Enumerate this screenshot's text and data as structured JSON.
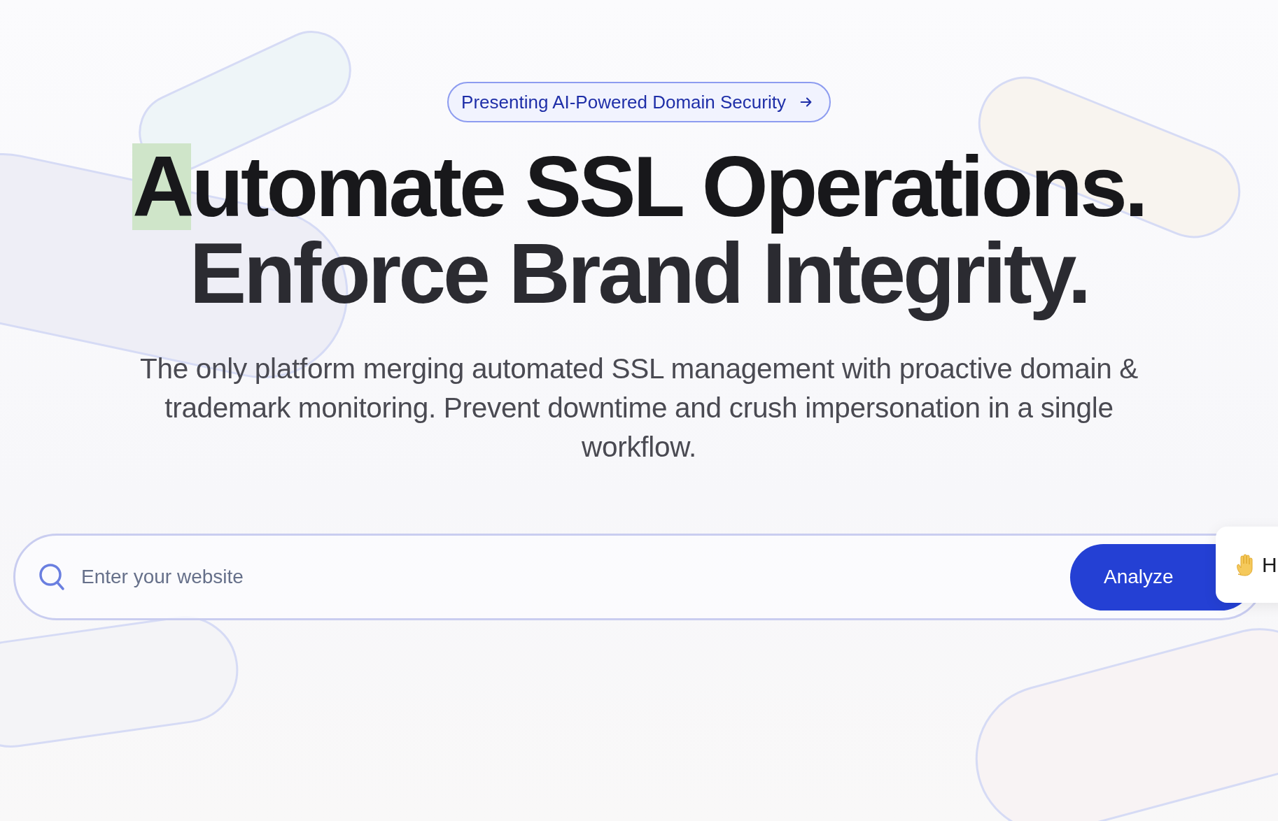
{
  "announcement": {
    "label": "Presenting AI-Powered Domain Security"
  },
  "headline": {
    "lines": [
      {
        "parts": [
          {
            "text": "A",
            "selected": true
          },
          {
            "text": "utomate SSL Operations.",
            "selected": false
          }
        ]
      },
      {
        "parts": [
          {
            "text": "Enforce Brand Integrity.",
            "selected": false
          }
        ]
      }
    ]
  },
  "description": "The only platform merging automated SSL management with proactive domain & trademark monitoring. Prevent downtime and crush impersonation in a single workflow.",
  "search": {
    "placeholder": "Enter your website",
    "button": "Analyze"
  },
  "chat_popup": {
    "text": "H"
  }
}
